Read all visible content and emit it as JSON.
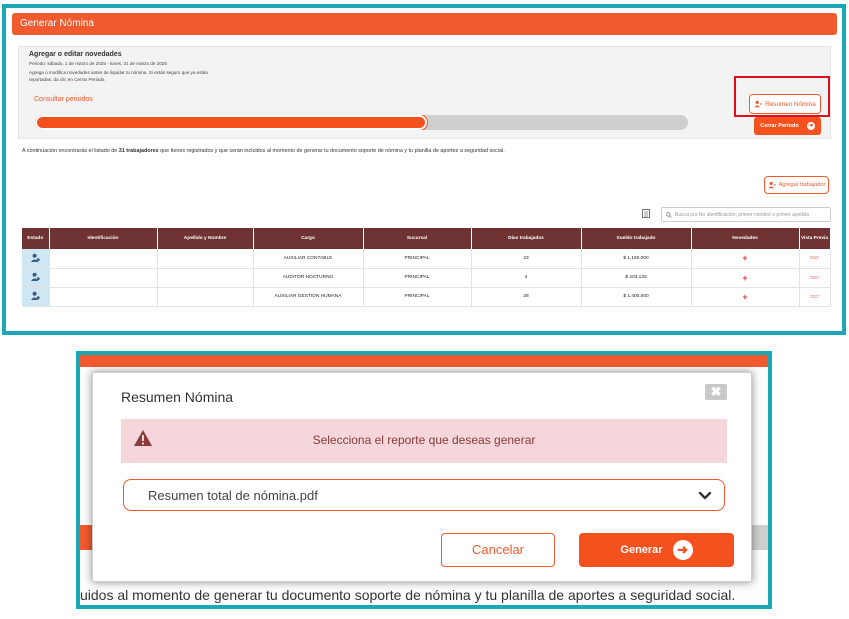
{
  "header": {
    "title": "Generar Nómina"
  },
  "novedades": {
    "title": "Agregar o editar novedades",
    "period_line": "Periodo: sábado, 1 de marzo de 2025 - lunes, 31 de marzo de 2025",
    "hint_line1": "Agrega o modifica novedades antes de liquidar tu nómina. Si estás seguro que ya están",
    "hint_line2": "reportadas, da clic en Cerrar Periodo.",
    "consultar_label": "Consultar periodos",
    "progress_fraction": 0.6
  },
  "actions": {
    "resumen_label": "Resumen Nómina",
    "cerrar_label": "Cerrar Periodo",
    "agregar_label": "Agregar trabajador"
  },
  "intro": {
    "before": "A continuación encontrarás el listado de ",
    "count": "31 trabajadores",
    "after": " que tienes registrados y que serán incluidos al momento de generar tu documento soporte de nómina y tu planilla de aportes a seguridad social."
  },
  "search": {
    "placeholder": "Busca por No identificación, primer nombre o primer apellido"
  },
  "table": {
    "headers": [
      "Estado",
      "Identificación",
      "Apellido y Nombre",
      "Cargo",
      "Sucursal",
      "Días trabajados",
      "Sueldo trabajado",
      "Novedades",
      "Vista Previa"
    ],
    "rows": [
      {
        "cargo": "AUXILIAR CONTABLE",
        "sucursal": "PRINCIPAL",
        "dias": "23",
        "sueldo": "$ 1.150.000"
      },
      {
        "cargo": "AUDITOR NOCTURNO",
        "sucursal": "PRINCIPAL",
        "dias": "4",
        "sueldo": "$ 203.133"
      },
      {
        "cargo": "AUXILIAR GESTION HUMANA",
        "sucursal": "PRINCIPAL",
        "dias": "28",
        "sueldo": "$ 1.400.000"
      }
    ]
  },
  "modal": {
    "title": "Resumen Nómina",
    "close_glyph": "✖",
    "alert_text": "Selecciona el reporte que deseas generar",
    "selected_report": "Resumen total de nómina.pdf",
    "cancel_label": "Cancelar",
    "generate_label": "Generar"
  },
  "background_text": "uidos al momento de generar tu documento soporte de nómina y tu planilla de aportes a seguridad social.",
  "colors": {
    "accent": "#f05a2e",
    "frame": "#1ba7b5",
    "table_header": "#6e3332",
    "alert_bg": "#f5d6da"
  },
  "icons": [
    "user-plus-icon",
    "arrow-circle-right-icon",
    "excel-icon",
    "search-icon",
    "user-icon",
    "plus-icon",
    "eye-icon",
    "warning-icon",
    "chevron-down-icon",
    "close-icon"
  ]
}
